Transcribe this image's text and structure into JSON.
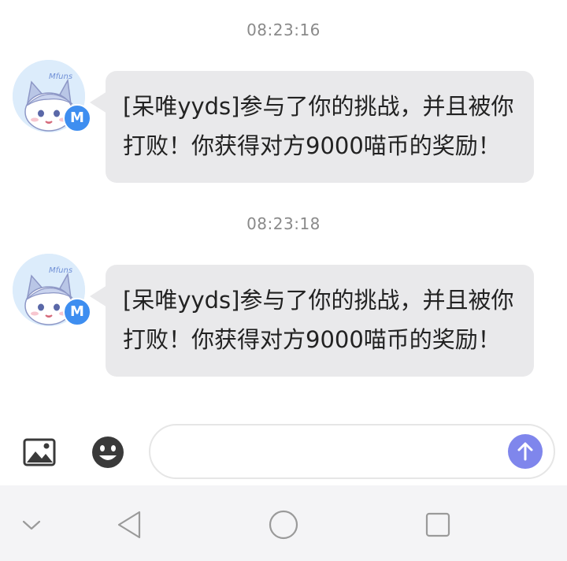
{
  "messages": [
    {
      "timestamp": "08:23:16",
      "avatar_badge": "M",
      "avatar_text": "Mfuns",
      "text": "[呆唯yyds]参与了你的挑战，并且被你打败！你获得对方9000喵币的奖励！"
    },
    {
      "timestamp": "08:23:18",
      "avatar_badge": "M",
      "avatar_text": "Mfuns",
      "text": "[呆唯yyds]参与了你的挑战，并且被你打败！你获得对方9000喵币的奖励！"
    }
  ],
  "input": {
    "value": "",
    "placeholder": ""
  },
  "colors": {
    "bubble": "#e9e9eb",
    "send_button": "#7f86ec",
    "badge": "#3e8ef0",
    "nav_bar": "#f4f4f6",
    "timestamp": "#8a8a8a"
  },
  "icons": {
    "image": "image-icon",
    "emoji": "emoji-icon",
    "send": "arrow-up-icon",
    "nav_collapse": "chevron-down-icon",
    "nav_back": "triangle-back-icon",
    "nav_home": "circle-home-icon",
    "nav_recents": "square-recents-icon"
  }
}
